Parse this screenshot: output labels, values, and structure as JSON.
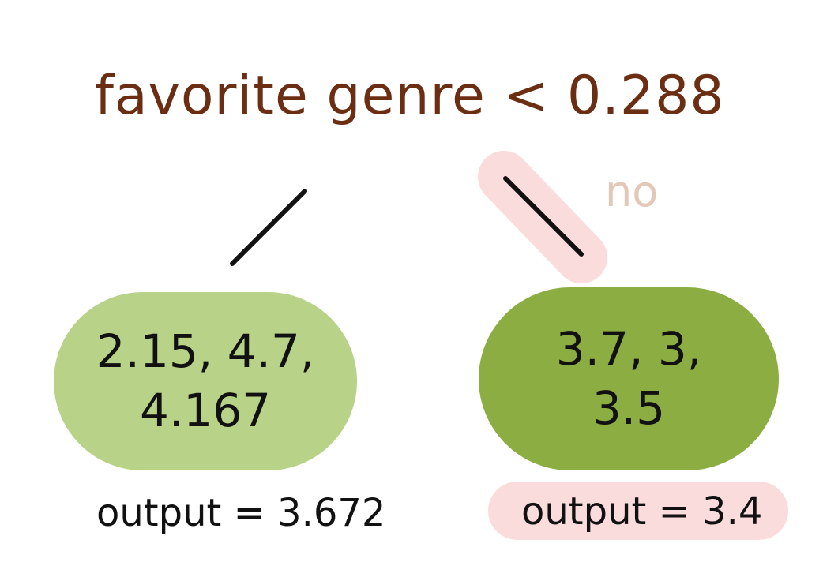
{
  "split": {
    "text": "favorite genre < 0.288"
  },
  "branch_right": {
    "label": "no"
  },
  "leaf_left": {
    "values_line1": "2.15, 4.7,",
    "values_line2": "4.167",
    "output": "output = 3.672"
  },
  "leaf_right": {
    "values_line1": "3.7, 3,",
    "values_line2": "3.5",
    "output": "output = 3.4"
  },
  "colors": {
    "split_text": "#6b2e12",
    "no_label": "#e3c8b8",
    "leaf_left_fill": "#b8d288",
    "leaf_right_fill": "#8cad41",
    "highlight": "#fbdcdc",
    "ink": "#111111"
  }
}
